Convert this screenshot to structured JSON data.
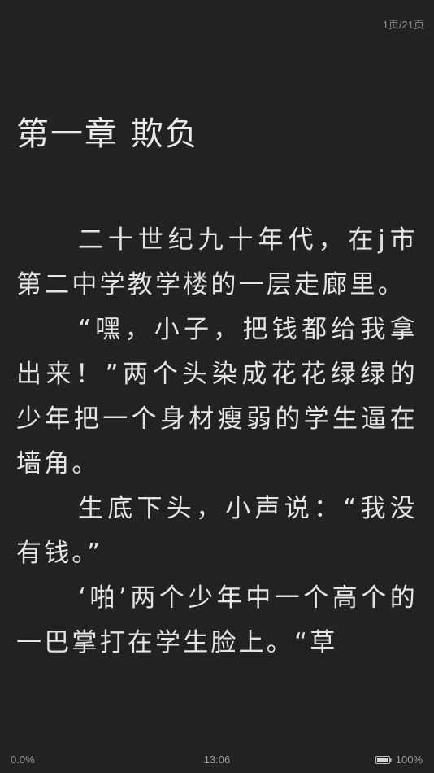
{
  "header": {
    "page_indicator": "1页/21页"
  },
  "chapter": {
    "title": "第一章 欺负"
  },
  "paragraphs": [
    "二十世纪九十年代，在j市第二中学教学楼的一层走廊里。",
    "“嘿，小子，把钱都给我拿出来！”两个头染成花花绿绿的少年把一个身材瘦弱的学生逼在墙角。",
    "生底下头，小声说：“我没有钱。”",
    "‘啪’两个少年中一个高个的一巴掌打在学生脸上。“草"
  ],
  "status": {
    "progress": "0.0%",
    "time": "13:06",
    "battery_percent": "100%",
    "battery_icon": "battery-full-icon"
  },
  "colors": {
    "background": "#222222",
    "text": "#e4e4e4",
    "muted": "#8e8e8e"
  }
}
